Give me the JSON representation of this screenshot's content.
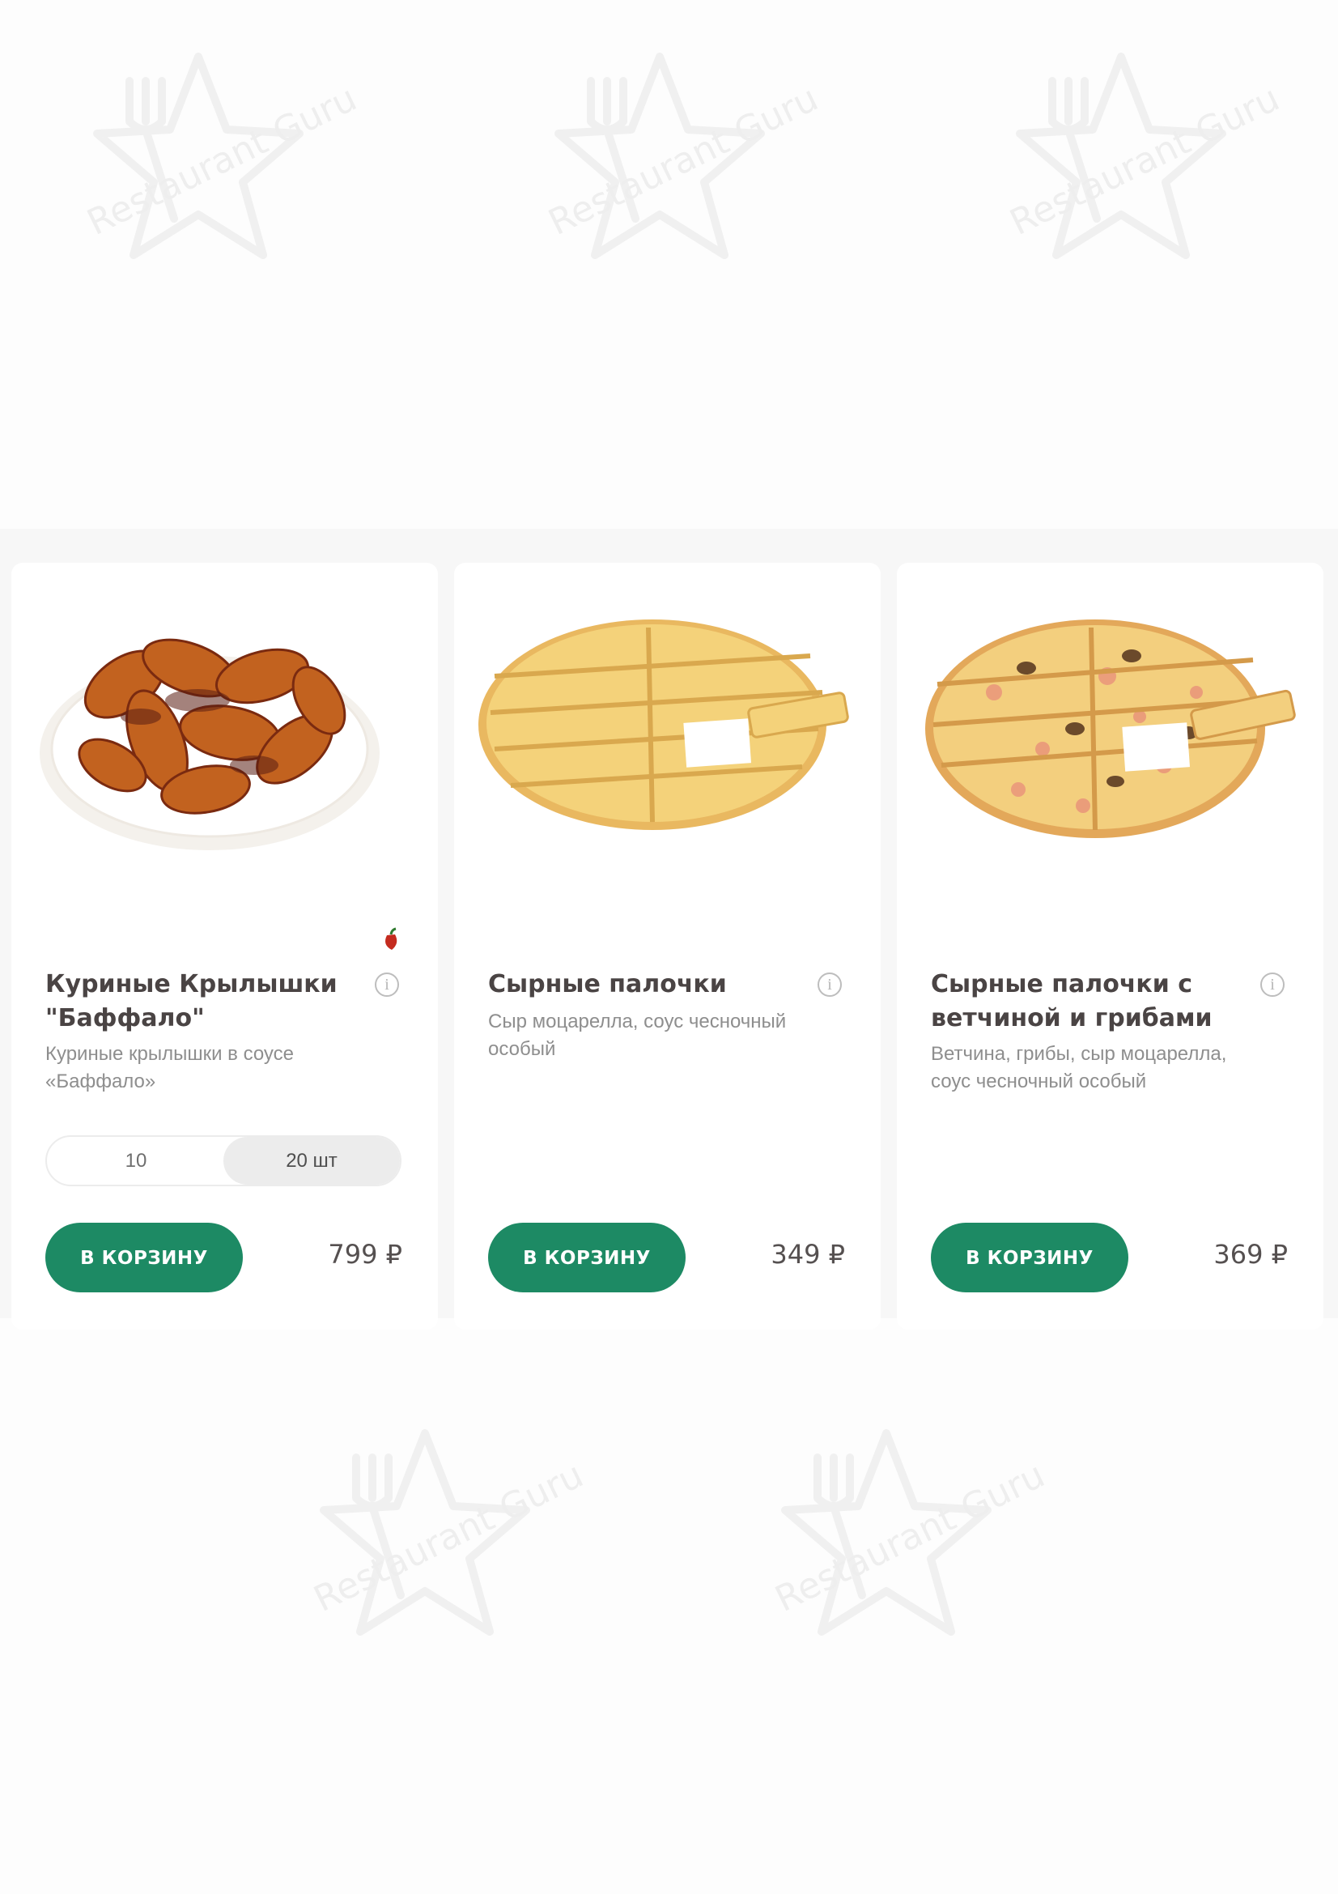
{
  "watermark": {
    "text": "Restaurant Guru"
  },
  "colors": {
    "accent": "#1d8a64",
    "title": "#4a4444",
    "description": "#8e8e8e"
  },
  "products": [
    {
      "title": "Куриные Крылышки \"Баффало\"",
      "description": "Куриные крылышки в соусе «Баффало»",
      "badge_icon": "chili-pepper-icon",
      "sizes": [
        "10",
        "20 шт"
      ],
      "selected_size": "20 шт",
      "cart_label": "В КОРЗИНУ",
      "price": "799 ₽"
    },
    {
      "title": "Сырные палочки",
      "description": "Сыр моцарелла, соус чесночный особый",
      "cart_label": "В КОРЗИНУ",
      "price": "349 ₽"
    },
    {
      "title": "Сырные палочки с ветчиной и грибами",
      "description": "Ветчина, грибы, сыр моцарелла, соус чесночный особый",
      "cart_label": "В КОРЗИНУ",
      "price": "369 ₽"
    }
  ]
}
